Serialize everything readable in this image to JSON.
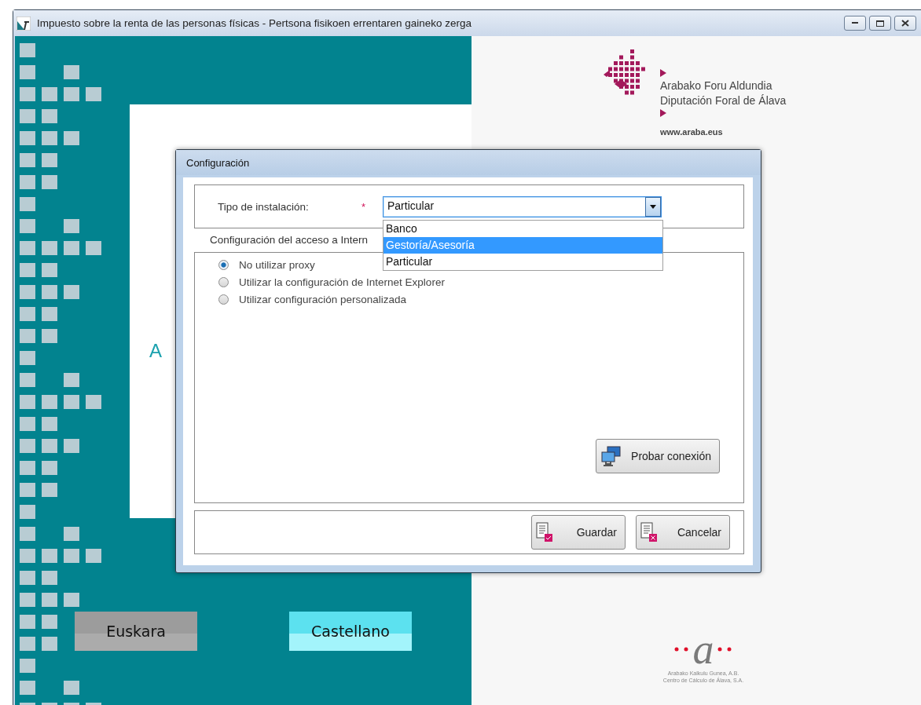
{
  "window": {
    "title": "Impuesto sobre la renta de las personas físicas -  Pertsona fisikoen errentaren gaineko zerga"
  },
  "splash": {
    "heading": "A",
    "languages": [
      {
        "label": "Euskara",
        "selected": false
      },
      {
        "label": "Castellano",
        "selected": true
      }
    ]
  },
  "brand": {
    "lines": [
      "Arabako Foru Aldundia",
      "Diputación Foral de Álava"
    ],
    "url": "www.araba.eus"
  },
  "footer_logo": {
    "letter": "a",
    "lines": [
      "Arabako Kalkulu Gunea, A.B.",
      "Centro de Cálculo de Álava, S.A."
    ]
  },
  "dialog": {
    "title": "Configuración",
    "install_type": {
      "label": "Tipo de instalación:",
      "required_mark": "*",
      "value": "Particular",
      "expanded": true,
      "options": [
        {
          "label": "Banco",
          "highlighted": false
        },
        {
          "label": "Gestoría/Asesoría",
          "highlighted": true
        },
        {
          "label": "Particular",
          "highlighted": false
        }
      ]
    },
    "proxy_section": {
      "label": "Configuración del acceso a Intern",
      "options": [
        {
          "label": "No utilizar proxy",
          "selected": true
        },
        {
          "label": "Utilizar la configuración de Internet Explorer",
          "selected": false
        },
        {
          "label": "Utilizar configuración personalizada",
          "selected": false
        }
      ]
    },
    "test_button": "Probar conexión",
    "buttons": [
      {
        "kind": "save",
        "label": "Guardar"
      },
      {
        "kind": "cancel",
        "label": "Cancelar"
      }
    ]
  }
}
